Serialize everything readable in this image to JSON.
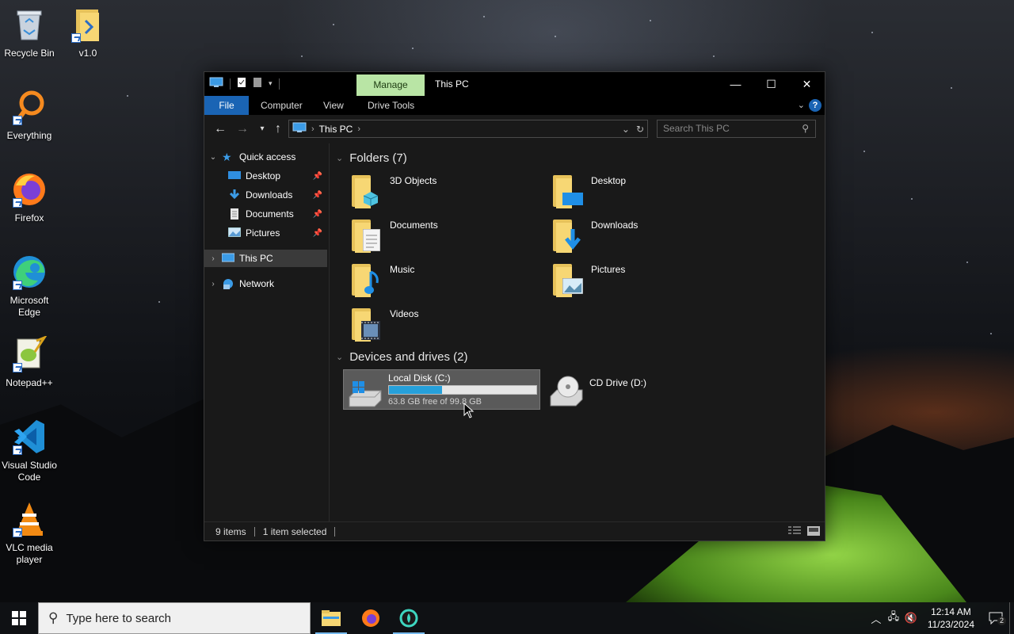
{
  "desktop": {
    "icons": [
      {
        "label": "Recycle Bin",
        "icon": "recycle-bin-icon"
      },
      {
        "label": "v1.0",
        "icon": "folder-icon"
      },
      {
        "label": "Everything",
        "icon": "everything-search-icon"
      },
      {
        "label": "Firefox",
        "icon": "firefox-icon"
      },
      {
        "label": "Microsoft Edge",
        "icon": "edge-icon"
      },
      {
        "label": "Notepad++",
        "icon": "notepad-plus-plus-icon"
      },
      {
        "label": "Visual Studio Code",
        "icon": "vscode-icon"
      },
      {
        "label": "VLC media player",
        "icon": "vlc-icon"
      }
    ]
  },
  "window": {
    "title": "This PC",
    "contextual_tab": "Manage",
    "ribbon_tabs": [
      "File",
      "Computer",
      "View",
      "Drive Tools"
    ],
    "address": {
      "crumbs": [
        "This PC"
      ]
    },
    "search_placeholder": "Search This PC",
    "nav": {
      "quick_access": "Quick access",
      "items": [
        {
          "label": "Desktop",
          "icon": "desktop-icon",
          "pinned": true
        },
        {
          "label": "Downloads",
          "icon": "downloads-icon",
          "pinned": true
        },
        {
          "label": "Documents",
          "icon": "documents-icon",
          "pinned": true
        },
        {
          "label": "Pictures",
          "icon": "pictures-icon",
          "pinned": true
        }
      ],
      "this_pc": "This PC",
      "network": "Network"
    },
    "folders_header": "Folders (7)",
    "folders": [
      {
        "name": "3D Objects",
        "icon": "3d-objects-folder-icon"
      },
      {
        "name": "Desktop",
        "icon": "desktop-folder-icon"
      },
      {
        "name": "Documents",
        "icon": "documents-folder-icon"
      },
      {
        "name": "Downloads",
        "icon": "downloads-folder-icon"
      },
      {
        "name": "Music",
        "icon": "music-folder-icon"
      },
      {
        "name": "Pictures",
        "icon": "pictures-folder-icon"
      },
      {
        "name": "Videos",
        "icon": "videos-folder-icon"
      }
    ],
    "drives_header": "Devices and drives (2)",
    "drives": [
      {
        "name": "Local Disk (C:)",
        "free_text": "63.8 GB free of 99.8 GB",
        "used_fraction": 0.36,
        "selected": true
      },
      {
        "name": "CD Drive (D:)"
      }
    ],
    "status": {
      "items": "9 items",
      "selected": "1 item selected"
    }
  },
  "taskbar": {
    "search_placeholder": "Type here to search",
    "apps": [
      "file-explorer-icon",
      "firefox-icon",
      "app-icon"
    ],
    "time": "12:14 AM",
    "date": "11/23/2024",
    "notification_count": "2"
  },
  "colors": {
    "accent": "#1a64b4",
    "manage_tab": "#b9e5a5",
    "progress": "#26a0da"
  }
}
